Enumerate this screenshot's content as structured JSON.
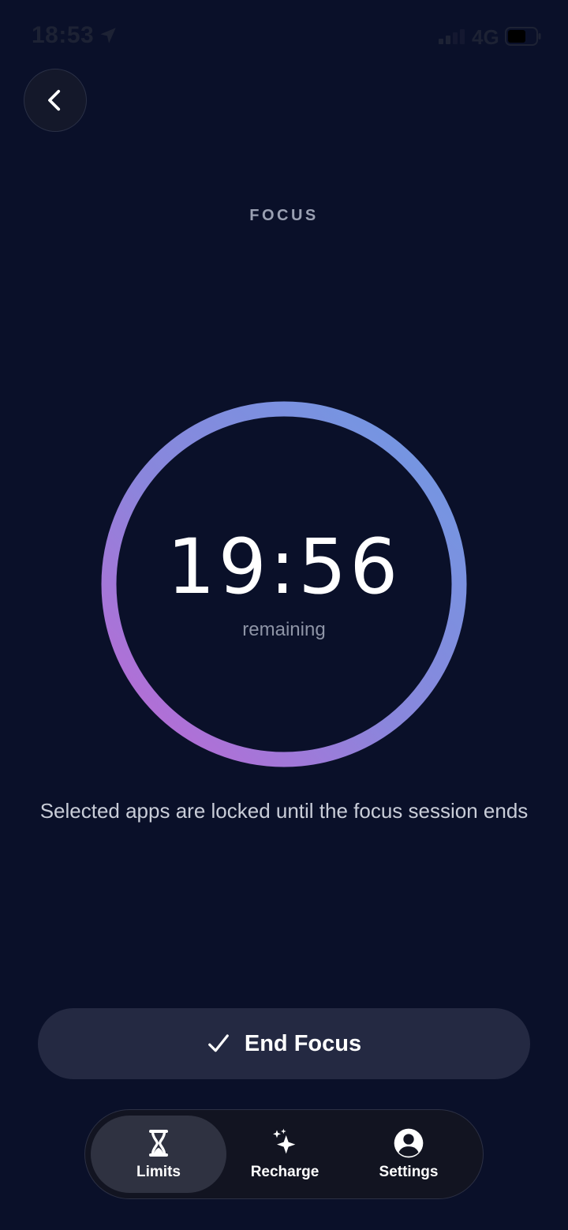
{
  "status_bar": {
    "time": "18:53",
    "network": "4G",
    "icons": [
      "location-arrow-icon",
      "signal-icon",
      "battery-icon"
    ]
  },
  "header": {
    "back_icon": "chevron-left-icon",
    "title": "FOCUS"
  },
  "timer": {
    "value": "19:56",
    "label": "remaining",
    "ring_gradient": [
      "#6f9ae3",
      "#b868d6"
    ]
  },
  "info": {
    "text": "Selected apps are locked until the focus session ends"
  },
  "actions": {
    "end_focus_label": "End Focus",
    "end_focus_icon": "checkmark-icon"
  },
  "tab_bar": {
    "tabs": [
      {
        "label": "Limits",
        "icon": "hourglass-icon",
        "active": true
      },
      {
        "label": "Recharge",
        "icon": "sparkles-icon",
        "active": false
      },
      {
        "label": "Settings",
        "icon": "person-circle-icon",
        "active": false
      }
    ]
  },
  "colors": {
    "background": "#0a1029",
    "button": "#242942",
    "tab_bar": "#121421",
    "tab_active": "#2f3241"
  }
}
